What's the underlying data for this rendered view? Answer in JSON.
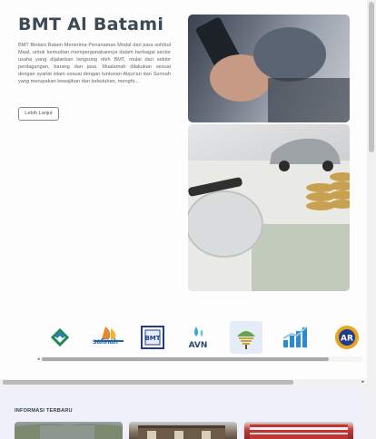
{
  "hero": {
    "title": "BMT Al Batami",
    "description": "BMT Bintaro Batam Menerima Penanaman Modal dari para sohibul Maal, untuk kemudian mempergunakannya dalam berbagai sector usaha yang dijalankan langsung oleh BMT, mulai dari sektor perdagangan, barang dan jasa. Mualamah dilakukan sesuai dengan syariat islam sesuai dengan tuntunan Alqur'an dan Sunnah yang merupakan kewajiban dan kebutuhan, menghi...",
    "button_label": "Lebih Lanjut"
  },
  "partners": [
    {
      "icon": "partner-logo-green-knot-icon",
      "label": ""
    },
    {
      "icon": "partner-logo-safinah-icon",
      "label": "safinah"
    },
    {
      "icon": "partner-logo-bmt-icon",
      "label": "BMT"
    },
    {
      "icon": "partner-logo-avn-icon",
      "label": "AVN"
    },
    {
      "icon": "partner-logo-tree-icon",
      "label": ""
    },
    {
      "icon": "partner-logo-bar-chart-icon",
      "label": ""
    },
    {
      "icon": "partner-logo-ar-icon",
      "label": "AR"
    }
  ],
  "news": {
    "section_title": "INFORMASI TERBARU"
  },
  "colors": {
    "title": "#3c4a56",
    "background": "#f0f1f8",
    "card": "#fdfdfd"
  }
}
